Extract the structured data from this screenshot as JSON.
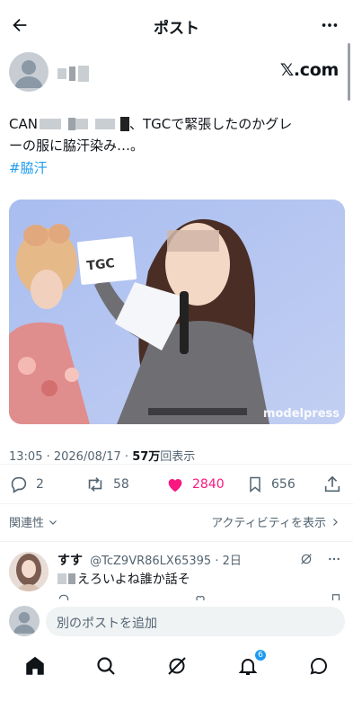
{
  "header": {
    "title": "ポスト"
  },
  "post": {
    "source": "𝕏.com",
    "text": "CAN　　　　　　　　　　　、TGCで緊張したのかグレーの服に脇汗染み…。",
    "text_prefix": "CAN",
    "text_suffix": "、TGCで緊張したのかグレ",
    "text_line2": "ーの服に脇汗染み…。",
    "hashtag": "#脇汗",
    "media": {
      "sign_text": "TGC",
      "watermark": "modelpress"
    },
    "time": "13:05 · 2026/08/17 · ",
    "views_count": "57万",
    "views_label": "回表示"
  },
  "actions": {
    "replies": "2",
    "reposts": "58",
    "likes": "2840",
    "bookmarks": "656"
  },
  "filters": {
    "relevance": "関連性",
    "activity": "アクティビティを表示"
  },
  "reply": {
    "name": "すす",
    "handle": "@TcZ9VR86LX65395",
    "age": "· 2日",
    "text": "えろいよね誰か話そ"
  },
  "compose": {
    "placeholder": "別のポストを追加"
  },
  "tabs": {
    "notifications_badge": "6"
  },
  "colors": {
    "accent": "#1d9bf0",
    "like": "#f91880",
    "secondary": "#536471"
  }
}
